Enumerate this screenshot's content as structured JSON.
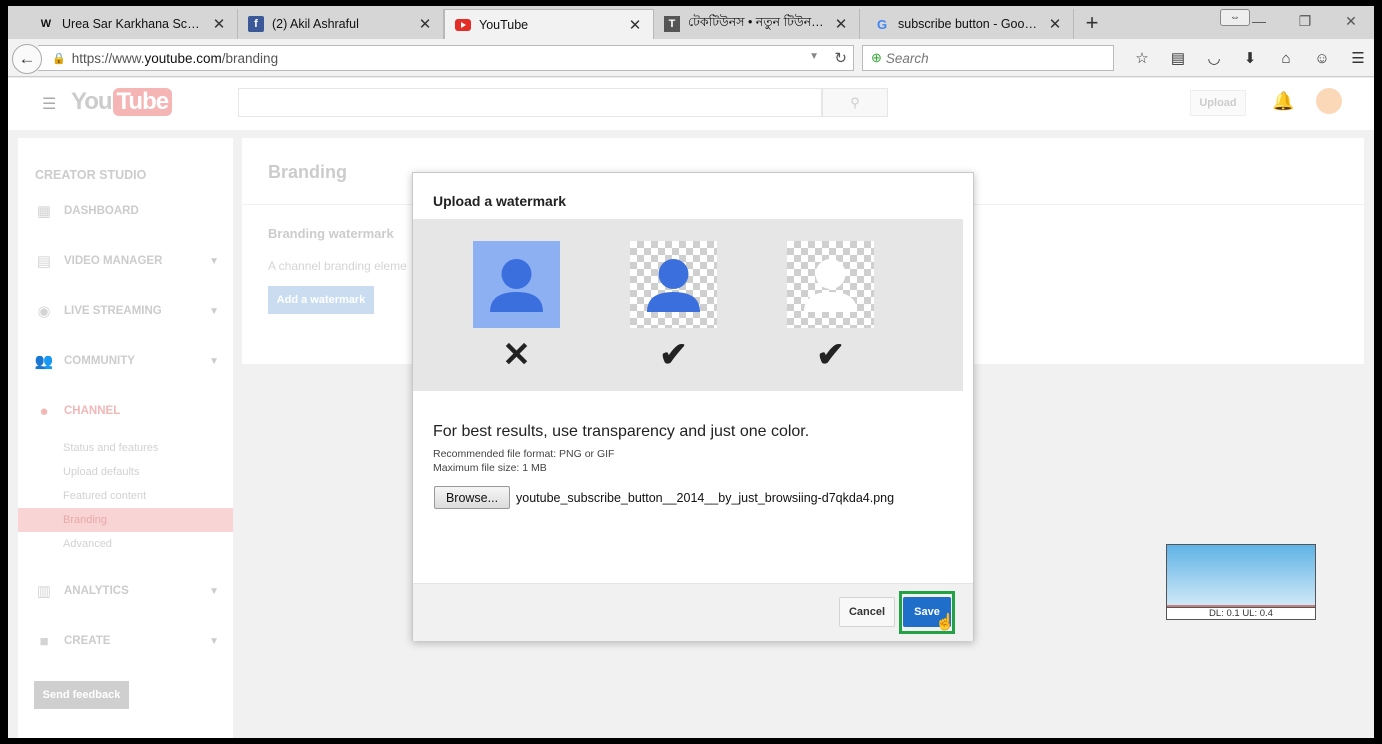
{
  "browser": {
    "tabs": [
      {
        "title": "Urea Sar Karkhana School ...",
        "favicon": "W",
        "active": false
      },
      {
        "title": "(2) Akil Ashraful",
        "favicon": "f",
        "active": false
      },
      {
        "title": "YouTube",
        "favicon": "youtube-icon",
        "active": true
      },
      {
        "title": "টেকটিউনস • নতুন টিউন করুন",
        "favicon": "T",
        "active": false
      },
      {
        "title": "subscribe button - Google...",
        "favicon": "G",
        "active": false
      }
    ],
    "url_prefix": "https://www.",
    "url_host": "youtube.com",
    "url_path": "/branding",
    "search_placeholder": "Search"
  },
  "youtube": {
    "logo_you": "You",
    "logo_tube": "Tube",
    "upload_label": "Upload"
  },
  "sidebar": {
    "title": "CREATOR STUDIO",
    "sections": [
      {
        "label": "DASHBOARD",
        "icon": "dashboard-icon",
        "chevron": false
      },
      {
        "label": "VIDEO MANAGER",
        "icon": "video-manager-icon",
        "chevron": true
      },
      {
        "label": "LIVE STREAMING",
        "icon": "live-streaming-icon",
        "chevron": true
      },
      {
        "label": "COMMUNITY",
        "icon": "community-icon",
        "chevron": true
      },
      {
        "label": "CHANNEL",
        "icon": "channel-icon",
        "chevron": false
      }
    ],
    "channel_items": [
      "Status and features",
      "Upload defaults",
      "Featured content",
      "Branding",
      "Advanced"
    ],
    "lower_sections": [
      {
        "label": "ANALYTICS",
        "icon": "analytics-icon"
      },
      {
        "label": "CREATE",
        "icon": "create-icon"
      }
    ],
    "feedback_label": "Send feedback"
  },
  "main": {
    "title": "Branding",
    "watermark_title": "Branding watermark",
    "watermark_desc": "A channel branding eleme",
    "add_watermark_label": "Add a watermark"
  },
  "modal": {
    "title": "Upload a watermark",
    "tip": "For best results, use transparency and just one color.",
    "format_note": "Recommended file format: PNG or GIF",
    "size_note": "Maximum file size: 1 MB",
    "browse_label": "Browse...",
    "filename": "youtube_subscribe_button__2014__by_just_browsiing-d7qkda4.png",
    "cancel_label": "Cancel",
    "save_label": "Save",
    "examples": [
      {
        "mark": "✕",
        "style": "blue-background"
      },
      {
        "mark": "✔",
        "style": "transparent-blue"
      },
      {
        "mark": "✔",
        "style": "transparent-white"
      }
    ]
  },
  "meter": {
    "label": "DL: 0.1 UL: 0.4"
  },
  "colors": {
    "save_button": "#1f6fca",
    "highlight": "#22a244",
    "channel_red": "#f2b7b7"
  }
}
